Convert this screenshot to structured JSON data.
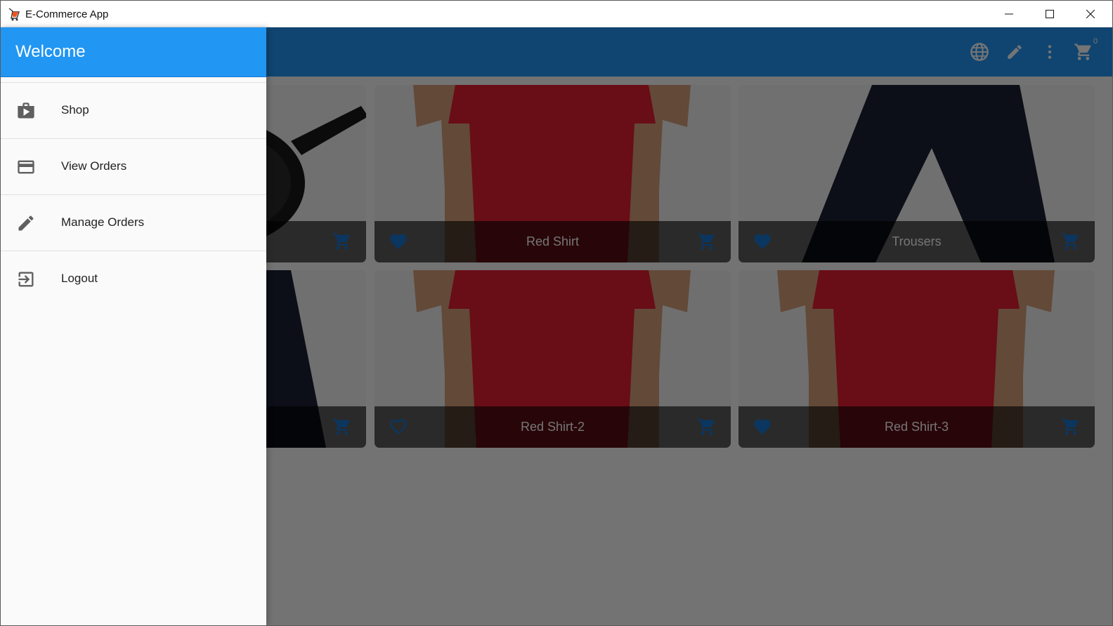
{
  "window": {
    "title": "E-Commerce App"
  },
  "appbar": {
    "cart_count": "0"
  },
  "products": [
    {
      "title": "",
      "favorite": true,
      "image": "skillet"
    },
    {
      "title": "Red Shirt",
      "favorite": true,
      "image": "red-shirt"
    },
    {
      "title": "Trousers",
      "favorite": true,
      "image": "trousers"
    },
    {
      "title": "",
      "favorite": true,
      "image": "trousers"
    },
    {
      "title": "Red Shirt-2",
      "favorite": false,
      "image": "red-shirt"
    },
    {
      "title": "Red Shirt-3",
      "favorite": true,
      "image": "red-shirt"
    }
  ],
  "drawer": {
    "header": "Welcome",
    "items": [
      {
        "label": "Shop",
        "icon": "shop-icon"
      },
      {
        "label": "View Orders",
        "icon": "credit-card-icon"
      },
      {
        "label": "Manage Orders",
        "icon": "pencil-icon"
      },
      {
        "label": "Logout",
        "icon": "logout-icon"
      }
    ]
  },
  "colors": {
    "primary": "#2196f3",
    "accent": "#1976d2"
  }
}
